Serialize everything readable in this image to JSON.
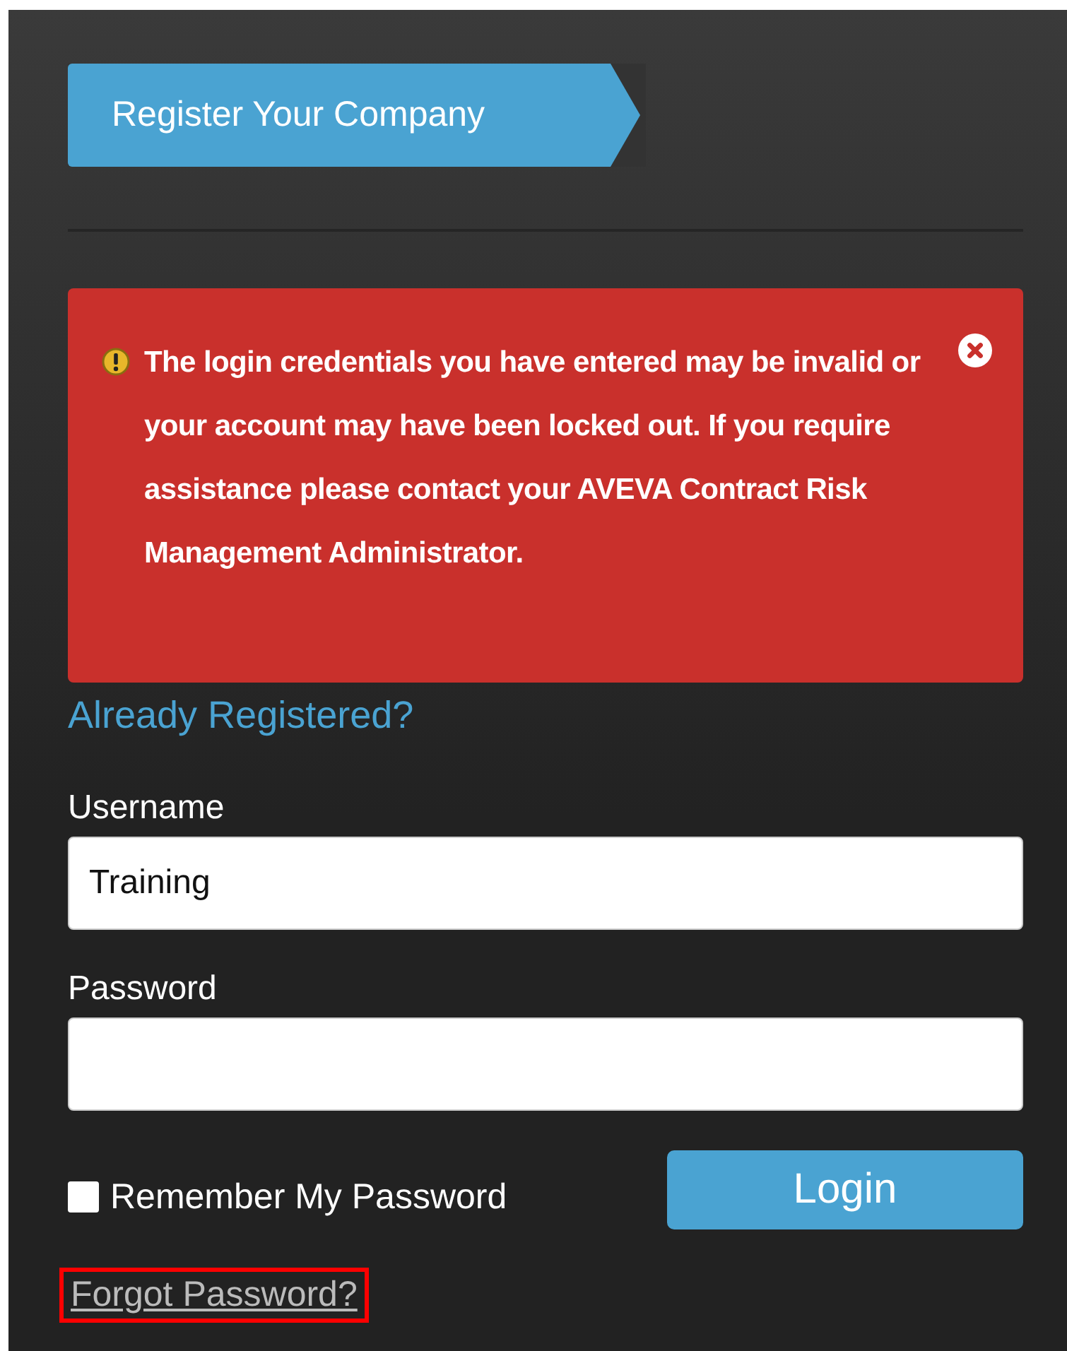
{
  "register_button": {
    "label": "Register Your Company"
  },
  "alert": {
    "message": "The login credentials you have entered may be invalid or your account may have been locked out. If you require assistance please contact your AVEVA Contract Risk Management Administrator."
  },
  "already_registered": "Already Registered?",
  "fields": [
    {
      "label": "Username",
      "value": "Training"
    },
    {
      "label": "Password"
    }
  ],
  "remember": {
    "label": "Remember My Password",
    "checked": false
  },
  "login_button": {
    "label": "Login"
  },
  "forgot_link": {
    "label": "Forgot Password?",
    "highlighted": true
  }
}
